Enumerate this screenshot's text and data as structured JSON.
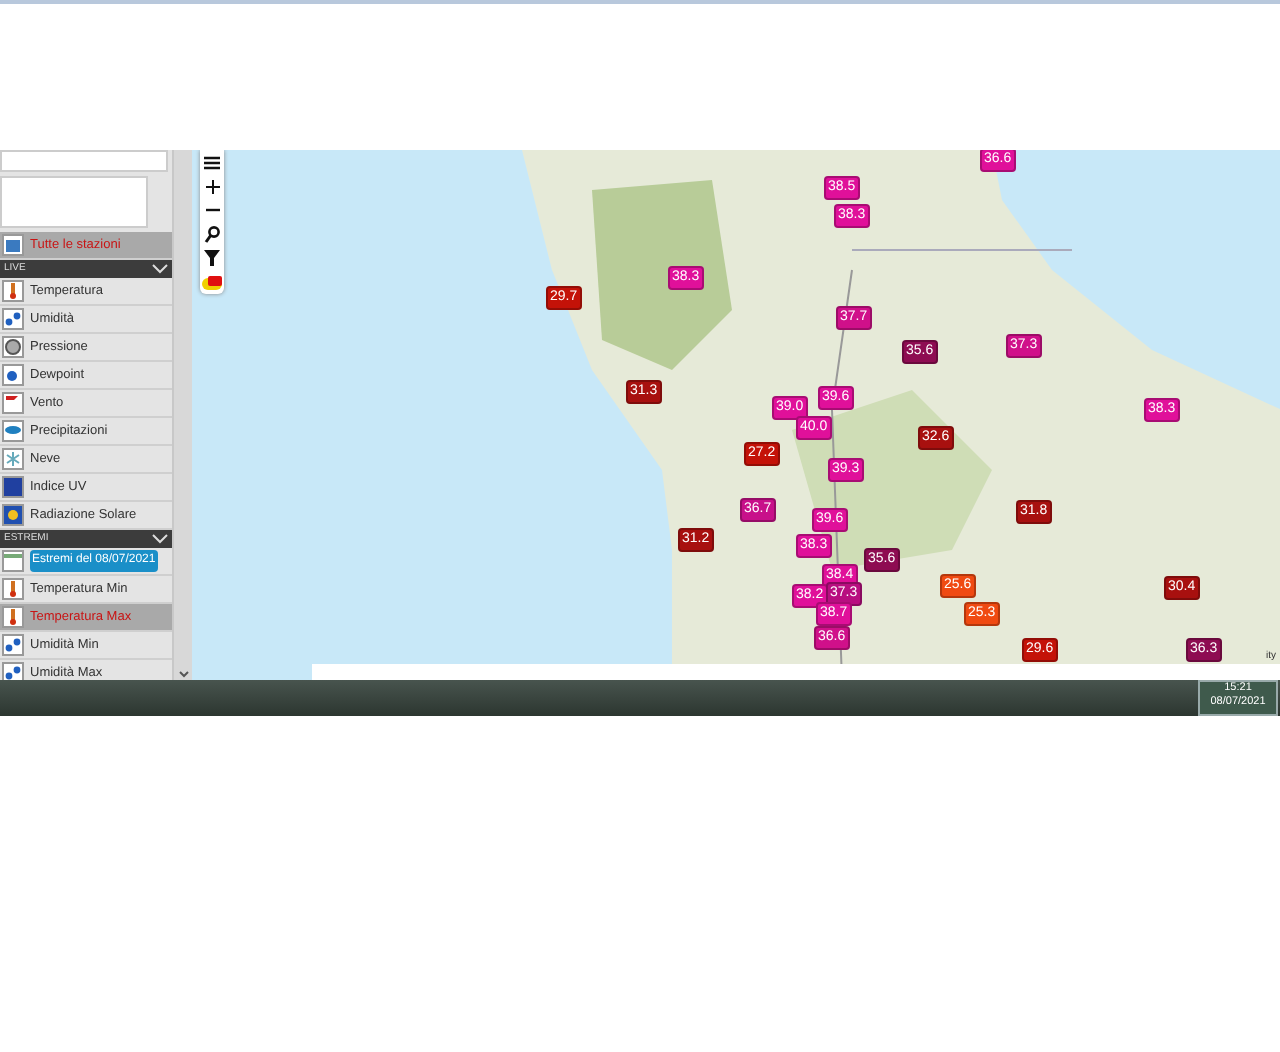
{
  "sidebar": {
    "items": [
      {
        "kind": "item",
        "label": "Tutte le stazioni",
        "selected": true
      },
      {
        "kind": "header",
        "label": "LIVE"
      },
      {
        "kind": "item",
        "label": "Temperatura",
        "selected": false
      },
      {
        "kind": "item",
        "label": "Umidità",
        "selected": false
      },
      {
        "kind": "item",
        "label": "Pressione",
        "selected": false
      },
      {
        "kind": "item",
        "label": "Dewpoint",
        "selected": false
      },
      {
        "kind": "item",
        "label": "Vento",
        "selected": false
      },
      {
        "kind": "item",
        "label": "Precipitazioni",
        "selected": false
      },
      {
        "kind": "item",
        "label": "Neve",
        "selected": false
      },
      {
        "kind": "item",
        "label": "Indice UV",
        "selected": false
      },
      {
        "kind": "item",
        "label": "Radiazione Solare",
        "selected": false
      },
      {
        "kind": "header",
        "label": "ESTREMI"
      },
      {
        "kind": "date",
        "label": "Estremi del 08/07/2021",
        "selected": false
      },
      {
        "kind": "item",
        "label": "Temperatura Min",
        "selected": false
      },
      {
        "kind": "item",
        "label": "Temperatura Max",
        "selected": true
      },
      {
        "kind": "item",
        "label": "Umidità Min",
        "selected": false
      },
      {
        "kind": "item",
        "label": "Umidità Max",
        "selected": false
      }
    ]
  },
  "map": {
    "markers": [
      {
        "value": "36.6",
        "color": "#e0109a"
      },
      {
        "value": "38.5",
        "color": "#e0109a"
      },
      {
        "value": "38.3",
        "color": "#e0109a"
      },
      {
        "value": "38.3",
        "color": "#e0109a"
      },
      {
        "value": "29.7",
        "color": "#c41208"
      },
      {
        "value": "37.7",
        "color": "#d0108a"
      },
      {
        "value": "35.6",
        "color": "#8e0c52"
      },
      {
        "value": "37.3",
        "color": "#d0108a"
      },
      {
        "value": "31.3",
        "color": "#a8100f"
      },
      {
        "value": "39.0",
        "color": "#e0109a"
      },
      {
        "value": "39.6",
        "color": "#e0109a"
      },
      {
        "value": "38.3",
        "color": "#e0109a"
      },
      {
        "value": "40.0",
        "color": "#e0109a"
      },
      {
        "value": "27.2",
        "color": "#c41208"
      },
      {
        "value": "32.6",
        "color": "#a8100f"
      },
      {
        "value": "39.3",
        "color": "#e0109a"
      },
      {
        "value": "36.7",
        "color": "#c8108a"
      },
      {
        "value": "31.8",
        "color": "#a8100f"
      },
      {
        "value": "39.6",
        "color": "#e0109a"
      },
      {
        "value": "31.2",
        "color": "#a8100f"
      },
      {
        "value": "38.3",
        "color": "#e0109a"
      },
      {
        "value": "35.6",
        "color": "#8e0c52"
      },
      {
        "value": "38.4",
        "color": "#e0109a"
      },
      {
        "value": "38.2",
        "color": "#e0109a"
      },
      {
        "value": "37.3",
        "color": "#b80e80"
      },
      {
        "value": "25.6",
        "color": "#f04a12"
      },
      {
        "value": "30.4",
        "color": "#a8100f"
      },
      {
        "value": "25.3",
        "color": "#f04a12"
      },
      {
        "value": "38.7",
        "color": "#e0109a"
      },
      {
        "value": "36.6",
        "color": "#d0108a"
      },
      {
        "value": "29.6",
        "color": "#c41208"
      },
      {
        "value": "36.3",
        "color": "#8e0c52"
      }
    ],
    "attribution": "ity"
  },
  "clock": {
    "time": "15:21",
    "date": "08/07/2021"
  }
}
